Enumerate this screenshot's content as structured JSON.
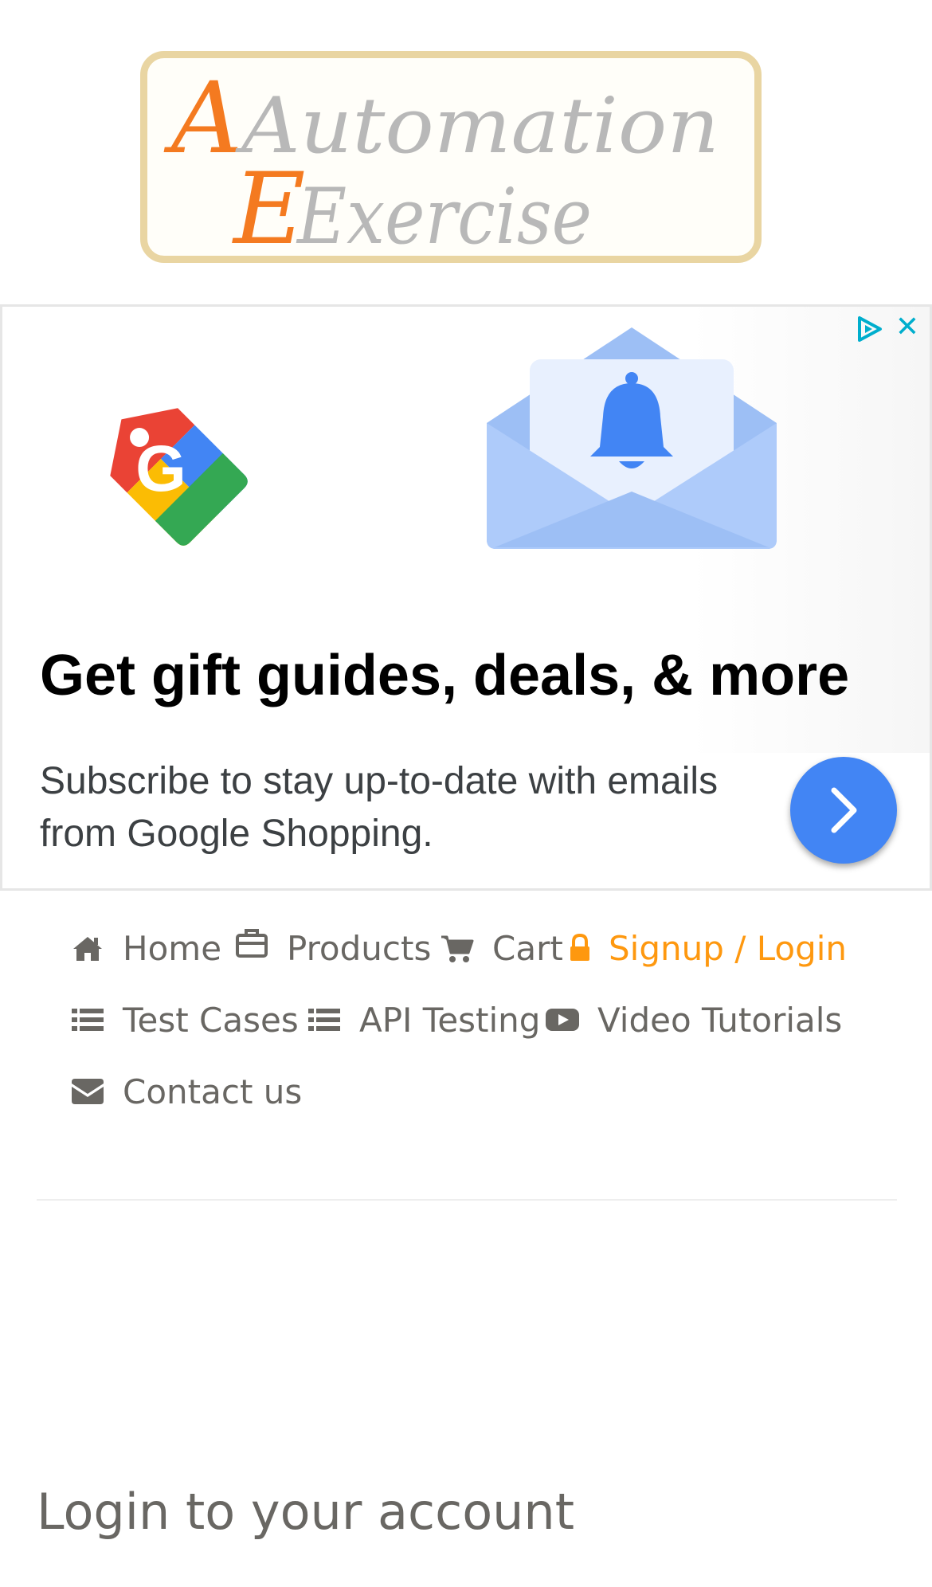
{
  "logo": {
    "line1": "Automation",
    "line2": "Exercise"
  },
  "ad": {
    "headline": "Get gift guides, deals, & more",
    "body": "Subscribe to stay up-to-date with emails from Google Shopping.",
    "icons": [
      "google-shopping-tag-icon",
      "email-bell-icon",
      "adchoices-icon",
      "close-icon",
      "chevron-right-icon"
    ],
    "colors": {
      "cta": "#4285f4",
      "close": "#00aecd",
      "envelope": "#aecbfa",
      "bell": "#4285f4"
    }
  },
  "nav": {
    "items": [
      {
        "label": "Home",
        "icon": "home-icon",
        "active": false
      },
      {
        "label": "Products",
        "icon": "briefcase-icon",
        "active": false
      },
      {
        "label": "Cart",
        "icon": "cart-icon",
        "active": false
      },
      {
        "label": "Signup / Login",
        "icon": "lock-icon",
        "active": true
      },
      {
        "label": "Test Cases",
        "icon": "list-icon",
        "active": false
      },
      {
        "label": "API Testing",
        "icon": "list-icon",
        "active": false
      },
      {
        "label": "Video Tutorials",
        "icon": "youtube-play-icon",
        "active": false
      },
      {
        "label": "Contact us",
        "icon": "envelope-icon",
        "active": false
      }
    ],
    "colors": {
      "text": "#696763",
      "active": "#fe980f"
    }
  },
  "login": {
    "title": "Login to your account"
  }
}
